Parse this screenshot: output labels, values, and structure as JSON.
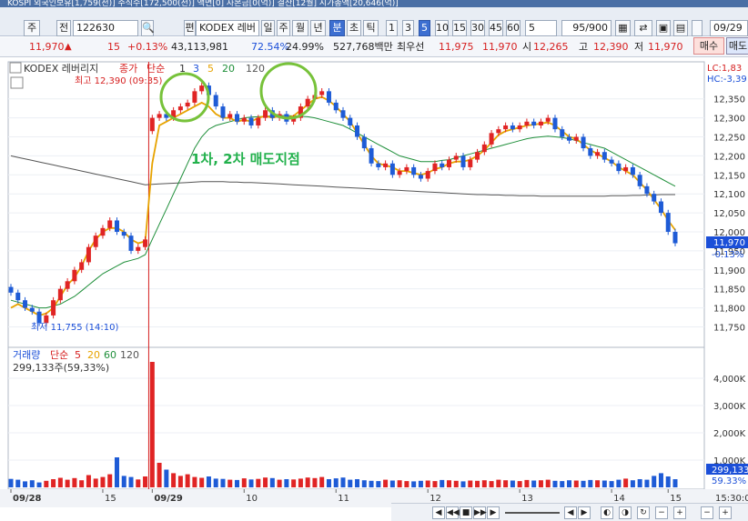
{
  "window": {
    "title": "KOSPI 외국인보유[1,759(천)] 주식수[172,500(천)] 액면[0] 자본금[0(억)] 결산[12월] 시가총액[20,646(억)]"
  },
  "toolbar": {
    "market": "주",
    "prev_label": "전",
    "code": "122630",
    "name_prefix": "편",
    "name": "KODEX 레버",
    "periods": [
      "일",
      "주",
      "월",
      "년",
      "분",
      "초",
      "틱"
    ],
    "active_period": "분",
    "intervals": [
      "1",
      "3",
      "5",
      "10",
      "15",
      "30",
      "45",
      "60"
    ],
    "active_interval": "5",
    "interval_select": "5",
    "count_value": "95/900",
    "date_value": "09/29"
  },
  "quote": {
    "price": "11,970",
    "change_arrow": "▲",
    "change": "15",
    "change_rate": "+0.13%",
    "volume": "43,113,981",
    "vol_ratio": "72.54%",
    "turnover": "24.99%",
    "amount": "527,768백만",
    "best_bid_label": "최우선",
    "best_ask": "11,975",
    "best_bid": "11,970",
    "open_label": "시",
    "open": "12,265",
    "high_label": "고",
    "high": "12,390",
    "low_label": "저",
    "low": "11,970",
    "buy_label": "매수",
    "sell_label": "매도"
  },
  "chart_data": {
    "type": "candlestick",
    "symbol": "KODEX 레버리지",
    "legend": {
      "price_label": "종가",
      "ma_label": "단순",
      "periods": [
        "1",
        "3",
        "5",
        "20",
        "120"
      ]
    },
    "y_range": [
      11720,
      12390
    ],
    "y_ticks": [
      "12,350",
      "12,300",
      "12,250",
      "12,200",
      "12,150",
      "12,100",
      "12,050",
      "12,000",
      "11,950",
      "11,900",
      "11,850",
      "11,800",
      "11,750"
    ],
    "high_label": "최고 12,390 (09:35)",
    "low_label": "최저 11,755 (14:10)",
    "lc_label": "LC:1,83",
    "hc_label": "HC:-3,39",
    "current_price": "11,970",
    "current_rate": "-0.13%",
    "annotation": "1차, 2차 매도지점",
    "closes": [
      11840,
      11820,
      11800,
      11790,
      11760,
      11780,
      11820,
      11850,
      11870,
      11900,
      11920,
      11960,
      11990,
      12010,
      12030,
      12000,
      11990,
      11950,
      11960,
      11980,
      12300,
      12310,
      12300,
      12320,
      12330,
      12340,
      12370,
      12385,
      12360,
      12330,
      12300,
      12310,
      12290,
      12300,
      12280,
      12300,
      12320,
      12300,
      12310,
      12290,
      12300,
      12330,
      12350,
      12360,
      12370,
      12340,
      12320,
      12300,
      12280,
      12250,
      12220,
      12180,
      12170,
      12180,
      12150,
      12160,
      12170,
      12150,
      12140,
      12160,
      12180,
      12170,
      12190,
      12200,
      12170,
      12190,
      12210,
      12230,
      12260,
      12270,
      12280,
      12270,
      12280,
      12290,
      12280,
      12290,
      12300,
      12270,
      12250,
      12240,
      12250,
      12220,
      12200,
      12210,
      12190,
      12180,
      12160,
      12170,
      12150,
      12120,
      12100,
      12080,
      12050,
      12000,
      11970
    ],
    "ma5": [
      11800,
      11810,
      11800,
      11790,
      11780,
      11785,
      11800,
      11830,
      11860,
      11880,
      11910,
      11950,
      11980,
      12000,
      12010,
      12010,
      12000,
      11980,
      11970,
      11975,
      12180,
      12280,
      12290,
      12300,
      12310,
      12320,
      12330,
      12340,
      12330,
      12310,
      12300,
      12300,
      12290,
      12295,
      12290,
      12300,
      12305,
      12300,
      12305,
      12300,
      12305,
      12320,
      12335,
      12350,
      12355,
      12345,
      12330,
      12310,
      12290,
      12260,
      12230,
      12200,
      12180,
      12175,
      12170,
      12160,
      12160,
      12155,
      12150,
      12155,
      12165,
      12170,
      12180,
      12185,
      12185,
      12190,
      12200,
      12215,
      12235,
      12255,
      12265,
      12270,
      12275,
      12280,
      12282,
      12285,
      12288,
      12280,
      12265,
      12250,
      12245,
      12230,
      12215,
      12205,
      12195,
      12185,
      12170,
      12160,
      12150,
      12130,
      12110,
      12085,
      12060,
      12030,
      12005
    ],
    "ma20": [
      11820,
      11815,
      11810,
      11805,
      11800,
      11800,
      11805,
      11810,
      11820,
      11830,
      11845,
      11860,
      11875,
      11890,
      11900,
      11910,
      11920,
      11925,
      11930,
      11940,
      11980,
      12020,
      12060,
      12100,
      12140,
      12180,
      12220,
      12250,
      12270,
      12280,
      12285,
      12290,
      12295,
      12300,
      12302,
      12303,
      12304,
      12305,
      12306,
      12306,
      12305,
      12304,
      12303,
      12300,
      12295,
      12290,
      12285,
      12280,
      12270,
      12260,
      12250,
      12240,
      12230,
      12220,
      12210,
      12200,
      12195,
      12190,
      12185,
      12185,
      12185,
      12188,
      12190,
      12195,
      12200,
      12205,
      12210,
      12215,
      12220,
      12225,
      12230,
      12235,
      12240,
      12245,
      12248,
      12250,
      12252,
      12250,
      12248,
      12245,
      12240,
      12235,
      12230,
      12225,
      12220,
      12210,
      12200,
      12190,
      12180,
      12170,
      12160,
      12150,
      12140,
      12130,
      12120
    ],
    "ma120": [
      12200,
      12196,
      12192,
      12188,
      12184,
      12180,
      12176,
      12172,
      12168,
      12164,
      12160,
      12156,
      12152,
      12148,
      12144,
      12140,
      12136,
      12132,
      12128,
      12124,
      12125,
      12126,
      12127,
      12128,
      12129,
      12130,
      12131,
      12132,
      12132,
      12132,
      12132,
      12131,
      12131,
      12130,
      12130,
      12129,
      12128,
      12127,
      12126,
      12125,
      12124,
      12123,
      12122,
      12121,
      12120,
      12119,
      12118,
      12117,
      12116,
      12115,
      12114,
      12113,
      12112,
      12111,
      12110,
      12109,
      12108,
      12107,
      12106,
      12105,
      12104,
      12103,
      12102,
      12101,
      12100,
      12099,
      12098,
      12098,
      12097,
      12097,
      12096,
      12096,
      12095,
      12095,
      12095,
      12094,
      12094,
      12094,
      12094,
      12094,
      12094,
      12094,
      12094,
      12094,
      12094,
      12095,
      12095,
      12095,
      12096,
      12096,
      12097,
      12097,
      12098,
      12098,
      12098
    ],
    "volume_label": "거래량",
    "volume_ma_label": "단순",
    "volume_ma_periods": [
      "5",
      "20",
      "60",
      "120"
    ],
    "volume_value": "299,133주(59,33%)",
    "volume_ticks": [
      "4,000K",
      "3,000K",
      "2,000K",
      "1,000K"
    ],
    "volume_range": [
      0,
      4600
    ],
    "volumes": [
      310,
      280,
      220,
      260,
      180,
      240,
      300,
      350,
      280,
      340,
      260,
      450,
      320,
      380,
      480,
      1100,
      420,
      380,
      290,
      400,
      4600,
      900,
      650,
      520,
      420,
      480,
      380,
      350,
      400,
      320,
      310,
      280,
      270,
      330,
      290,
      310,
      360,
      340,
      280,
      300,
      290,
      320,
      360,
      340,
      380,
      300,
      330,
      360,
      280,
      300,
      260,
      240,
      230,
      280,
      250,
      260,
      230,
      220,
      240,
      250,
      230,
      270,
      260,
      240,
      220,
      250,
      240,
      260,
      230,
      280,
      260,
      250,
      230,
      270,
      250,
      260,
      280,
      240,
      230,
      260,
      250,
      240,
      270,
      260,
      250,
      230,
      280,
      320,
      260,
      300,
      280,
      420,
      520,
      400,
      299
    ],
    "current_volume": "299,133",
    "current_volume_rate": "59.33%",
    "x_labels": [
      "09/28",
      "15",
      "09/29",
      "10",
      "11",
      "12",
      "13",
      "14",
      "15"
    ],
    "time_label": "15:30:0"
  }
}
